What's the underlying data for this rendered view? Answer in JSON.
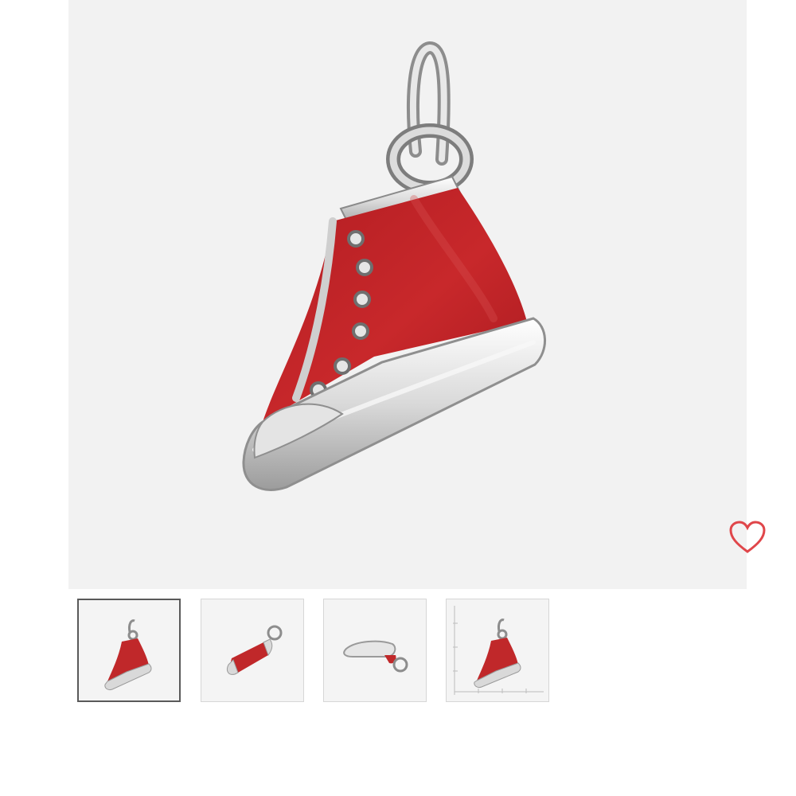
{
  "gallery": {
    "main_image": {
      "icon": "red-high-top-sneaker-charm",
      "accent": "#c0282a",
      "background": "#f2f2f2"
    },
    "favorite": {
      "icon": "heart-outline-icon",
      "color": "#e0464a"
    },
    "thumbnails": [
      {
        "icon": "sneaker-charm-side-view",
        "selected": true
      },
      {
        "icon": "sneaker-charm-angled-view",
        "selected": false
      },
      {
        "icon": "sneaker-charm-bottom-view",
        "selected": false
      },
      {
        "icon": "sneaker-charm-size-reference",
        "selected": false
      }
    ]
  }
}
